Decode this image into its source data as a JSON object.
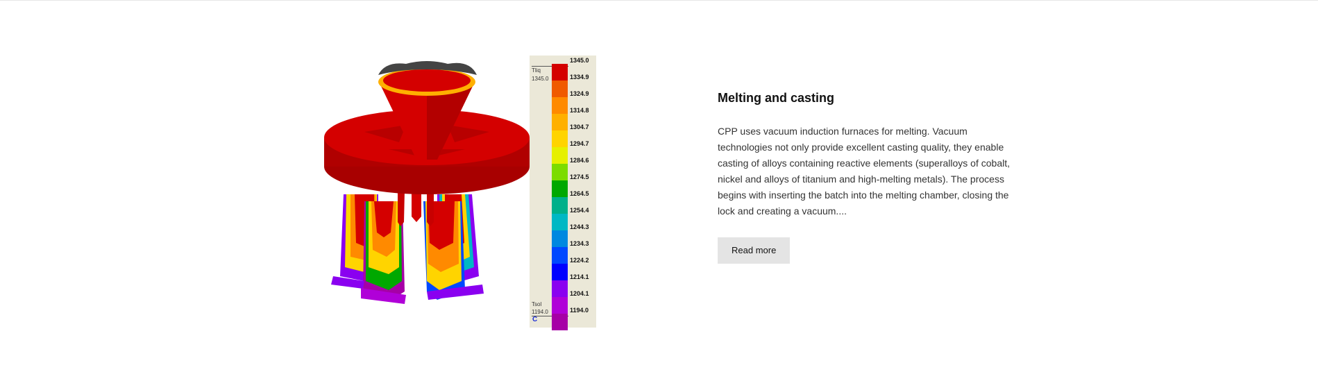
{
  "figure": {
    "legend": {
      "liquidus_label": "Tliq",
      "liquidus_value": "1345.0",
      "solidus_label": "Tsol",
      "solidus_value": "1194.0",
      "unit": "C",
      "ticks": [
        "1345.0",
        "1334.9",
        "1324.9",
        "1314.8",
        "1304.7",
        "1294.7",
        "1284.6",
        "1274.5",
        "1264.5",
        "1254.4",
        "1244.3",
        "1234.3",
        "1224.2",
        "1214.1",
        "1204.1",
        "1194.0"
      ],
      "colors": [
        "#d40000",
        "#f05a00",
        "#ff8a00",
        "#ffb000",
        "#ffd400",
        "#e6f000",
        "#7cdc00",
        "#00a800",
        "#00b08a",
        "#00b8c4",
        "#0088e0",
        "#0048ff",
        "#0000ff",
        "#8a00f0",
        "#b000d8",
        "#a600a6"
      ]
    }
  },
  "section": {
    "title": "Melting and casting",
    "description": "CPP uses vacuum induction furnaces for melting. Vacuum technologies not only provide excellent casting quality, they enable casting of alloys containing reactive elements (superalloys of cobalt, nickel and alloys of titanium and high-melting metals). The process begins with inserting the batch into the melting chamber, closing the lock and creating a vacuum....",
    "read_more_label": "Read more"
  }
}
